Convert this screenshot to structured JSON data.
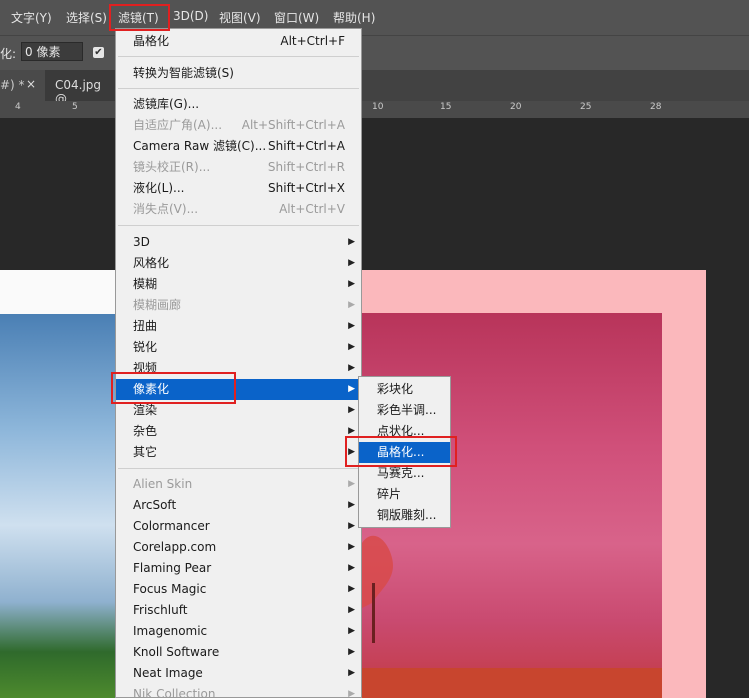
{
  "menubar": {
    "items": [
      "文字(Y)",
      "选择(S)",
      "滤镜(T)",
      "3D(D)",
      "视图(V)",
      "窗口(W)",
      "帮助(H)"
    ]
  },
  "options": {
    "label": "化:",
    "value": "0 像素"
  },
  "tabs": {
    "tab1": "#) *",
    "tab1_close": "×",
    "tab2": "C04.jpg @"
  },
  "ruler": {
    "labels": [
      "4",
      "5",
      "10",
      "15",
      "20",
      "25",
      "28"
    ]
  },
  "filter_menu": {
    "group1": [
      {
        "label": "晶格化",
        "shortcut": "Alt+Ctrl+F"
      }
    ],
    "group2": [
      {
        "label": "转换为智能滤镜(S)"
      }
    ],
    "group3": [
      {
        "label": "滤镜库(G)...",
        "shortcut": ""
      },
      {
        "label": "自适应广角(A)...",
        "shortcut": "Alt+Shift+Ctrl+A",
        "disabled": true
      },
      {
        "label": "Camera Raw 滤镜(C)...",
        "shortcut": "Shift+Ctrl+A"
      },
      {
        "label": "镜头校正(R)...",
        "shortcut": "Shift+Ctrl+R",
        "disabled": true
      },
      {
        "label": "液化(L)...",
        "shortcut": "Shift+Ctrl+X"
      },
      {
        "label": "消失点(V)...",
        "shortcut": "Alt+Ctrl+V",
        "disabled": true
      }
    ],
    "group4": [
      {
        "label": "3D"
      },
      {
        "label": "风格化"
      },
      {
        "label": "模糊"
      },
      {
        "label": "模糊画廊",
        "disabled": true
      },
      {
        "label": "扭曲"
      },
      {
        "label": "锐化"
      },
      {
        "label": "视频"
      },
      {
        "label": "像素化",
        "highlighted": true
      },
      {
        "label": "渲染"
      },
      {
        "label": "杂色"
      },
      {
        "label": "其它"
      }
    ],
    "group5": [
      {
        "label": "Alien Skin",
        "disabled": true
      },
      {
        "label": "ArcSoft"
      },
      {
        "label": "Colormancer"
      },
      {
        "label": "Corelapp.com"
      },
      {
        "label": "Flaming Pear"
      },
      {
        "label": "Focus Magic"
      },
      {
        "label": "Frischluft"
      },
      {
        "label": "Imagenomic"
      },
      {
        "label": "Knoll Software"
      },
      {
        "label": "Neat Image"
      },
      {
        "label": "Nik Collection",
        "disabled": true
      }
    ]
  },
  "pixelate_submenu": [
    {
      "label": "彩块化"
    },
    {
      "label": "彩色半调..."
    },
    {
      "label": "点状化..."
    },
    {
      "label": "晶格化...",
      "highlighted": true
    },
    {
      "label": "马赛克..."
    },
    {
      "label": "碎片"
    },
    {
      "label": "铜版雕刻..."
    }
  ],
  "colors": {
    "highlight": "#0a63c9",
    "annotation": "#e02020",
    "menu_bg": "#f0f0f0"
  }
}
